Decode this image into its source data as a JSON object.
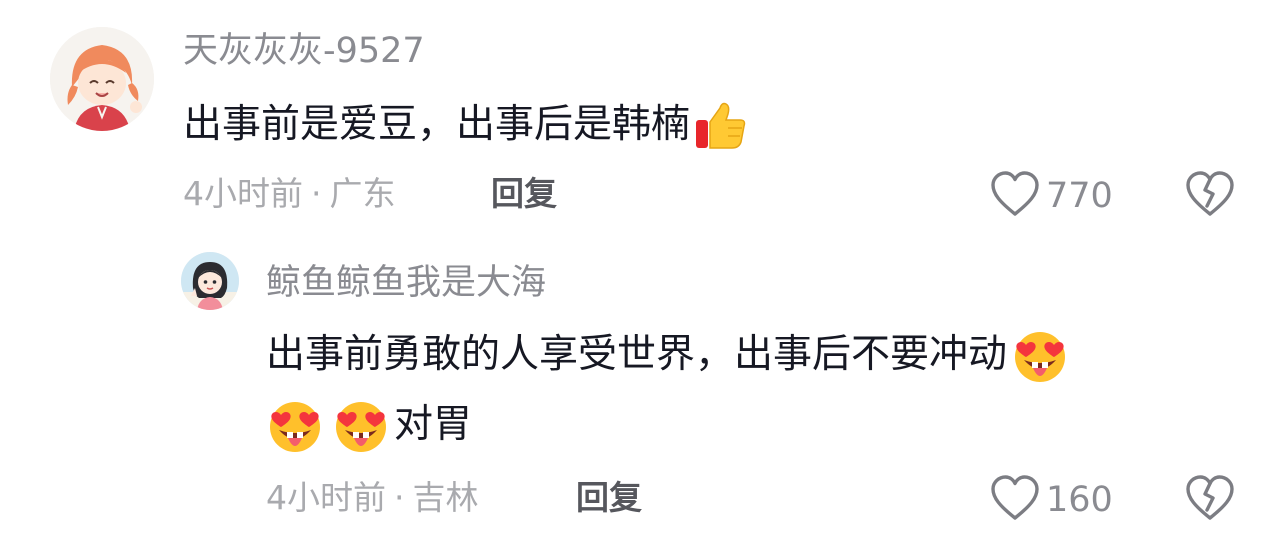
{
  "comments": [
    {
      "username": "天灰灰灰-9527",
      "text": "出事前是爱豆，出事后是韩楠",
      "time": "4小时前",
      "separator": "·",
      "location": "广东",
      "reply_label": "回复",
      "likes": "770",
      "emoji": "thumbs-up"
    },
    {
      "username": "鲸鱼鲸鱼我是大海",
      "text_line1": "出事前勇敢的人享受世界，出事后不要冲动",
      "text_line2": "对胃",
      "time": "4小时前",
      "separator": "·",
      "location": "吉林",
      "reply_label": "回复",
      "likes": "160",
      "emoji": "heart-eyes-tongue"
    }
  ],
  "icons": {
    "like": "heart-outline-icon",
    "dislike": "broken-heart-icon"
  },
  "colors": {
    "username": "#8a8b91",
    "meta": "#a9aaae",
    "text": "#161823"
  }
}
